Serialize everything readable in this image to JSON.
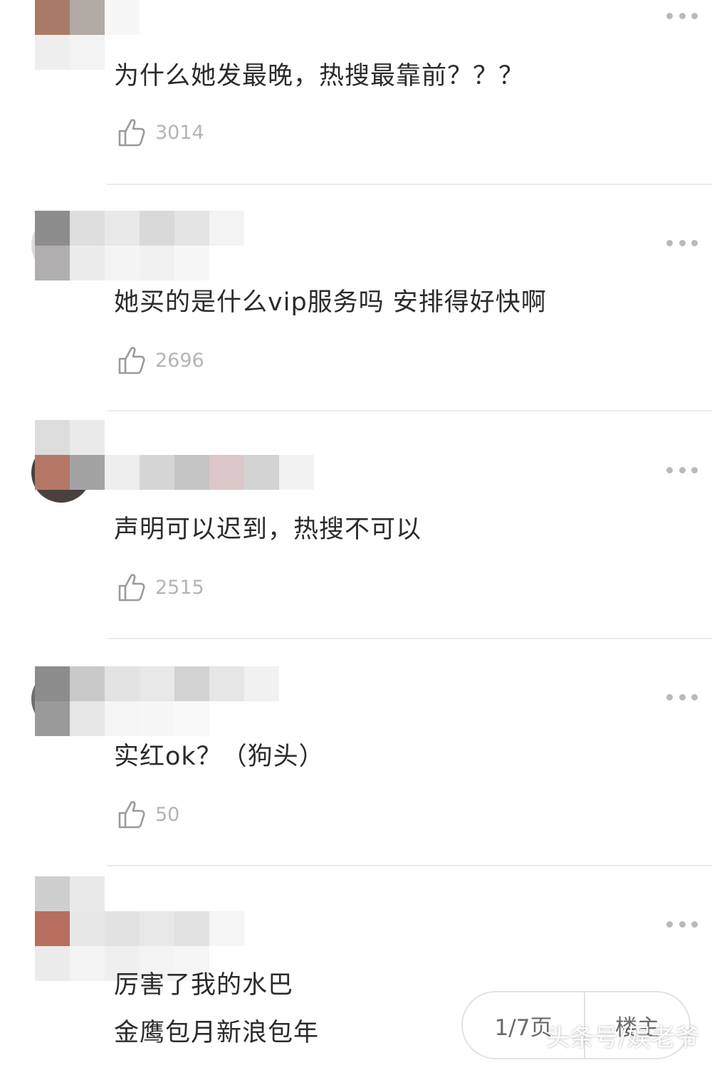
{
  "comments": [
    {
      "text": "为什么她发最晚，热搜最靠前？？？",
      "likes": "3014"
    },
    {
      "text": "她买的是什么vip服务吗 安排得好快啊",
      "likes": "2696"
    },
    {
      "text": "声明可以迟到，热搜不可以",
      "likes": "2515"
    },
    {
      "text": "实红ok？（狗头）",
      "likes": "50"
    },
    {
      "text": "厉害了我的水巴",
      "text2": "金鹰包月新浪包年"
    }
  ],
  "pager": {
    "page_label": "1/7页",
    "owner_label": "楼主"
  },
  "watermark": "头条号/娱老爷",
  "colors": {
    "text": "#2b2b2b",
    "muted": "#b4b4b4",
    "divider": "#ececec",
    "dots": "#b9b9b9"
  },
  "icons": {
    "like": "thumbs-up-icon",
    "more": "more-dots-icon"
  }
}
